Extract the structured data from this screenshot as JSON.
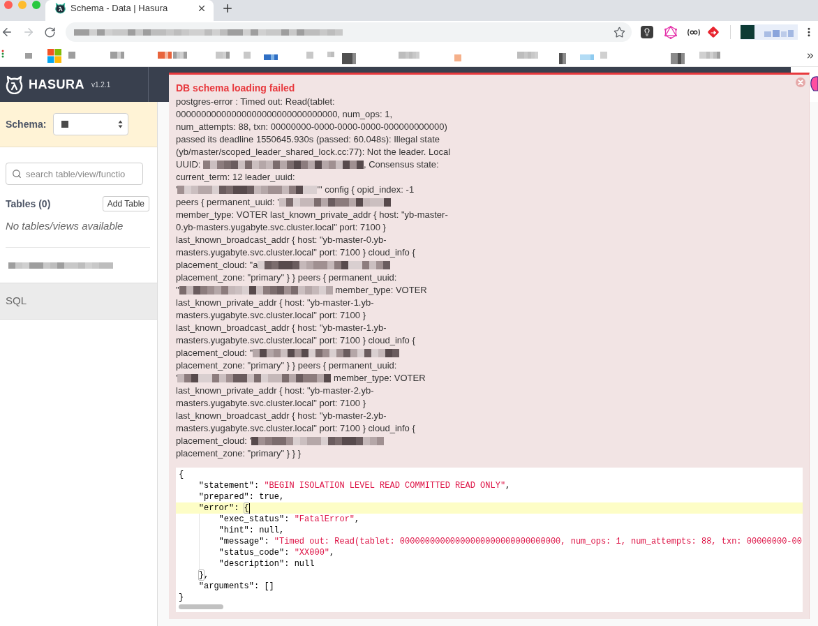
{
  "browser": {
    "tabs": [
      {
        "title": "Schema - Data | Hasura",
        "selected": true
      }
    ],
    "forward_button": {
      "disabled": true
    }
  },
  "header": {
    "logo": "HASURA",
    "version": "v1.2.1"
  },
  "sidebar": {
    "schema_label": "Schema:",
    "search": {
      "placeholder": "search table/view/functio"
    },
    "tables_heading": "Tables (0)",
    "add_table_button": "Add Table",
    "empty_message": "No tables/views available",
    "sql_link": "SQL"
  },
  "error_panel": {
    "title": "DB schema loading failed",
    "message_lines": [
      [
        {
          "kind": "text",
          "text": "postgres-error : Timed out: Read(tablet:"
        }
      ],
      [
        {
          "kind": "text",
          "text": "00000000000000000000000000000000, num_ops: 1,"
        }
      ],
      [
        {
          "kind": "text",
          "text": "num_attempts: 88, txn: 00000000-0000-0000-0000-000000000000)"
        }
      ],
      [
        {
          "kind": "text",
          "text": "passed its deadline 1550645.930s (passed: 60.048s): Illegal state"
        }
      ],
      [
        {
          "kind": "text",
          "text": "(yb/master/scoped_leader_shared_lock.cc:77): Not the leader. Local"
        }
      ],
      [
        {
          "kind": "text",
          "text": "UUID: "
        },
        {
          "kind": "redacted"
        },
        {
          "kind": "text",
          "text": ", Consensus state:"
        }
      ],
      [
        {
          "kind": "text",
          "text": "current_term: 12 leader_uuid:"
        }
      ],
      [
        {
          "kind": "text",
          "text": "'"
        },
        {
          "kind": "redacted"
        },
        {
          "kind": "text",
          "text": "'\" config { opid_index: -1"
        }
      ],
      [
        {
          "kind": "text",
          "text": "peers { permanent_uuid: '"
        },
        {
          "kind": "redacted"
        }
      ],
      [
        {
          "kind": "text",
          "text": "member_type: VOTER last_known_private_addr { host: \"yb-master-"
        }
      ],
      [
        {
          "kind": "text",
          "text": "0.yb-masters.yugabyte.svc.cluster.local\" port: 7100 }"
        }
      ],
      [
        {
          "kind": "text",
          "text": "last_known_broadcast_addr { host: \"yb-master-0.yb-"
        }
      ],
      [
        {
          "kind": "text",
          "text": "masters.yugabyte.svc.cluster.local\" port: 7100 } cloud_info {"
        }
      ],
      [
        {
          "kind": "text",
          "text": "placement_cloud: \"a"
        },
        {
          "kind": "redacted"
        }
      ],
      [
        {
          "kind": "text",
          "text": "placement_zone: \"primary\" } } peers { permanent_uuid:"
        }
      ],
      [
        {
          "kind": "text",
          "text": "\""
        },
        {
          "kind": "redacted"
        },
        {
          "kind": "text",
          "text": " member_type: VOTER"
        }
      ],
      [
        {
          "kind": "text",
          "text": "last_known_private_addr { host: \"yb-master-1.yb-"
        }
      ],
      [
        {
          "kind": "text",
          "text": "masters.yugabyte.svc.cluster.local\" port: 7100 }"
        }
      ],
      [
        {
          "kind": "text",
          "text": "last_known_broadcast_addr { host: \"yb-master-1.yb-"
        }
      ],
      [
        {
          "kind": "text",
          "text": "masters.yugabyte.svc.cluster.local\" port: 7100 } cloud_info {"
        }
      ],
      [
        {
          "kind": "text",
          "text": "placement_cloud: \""
        },
        {
          "kind": "redacted"
        }
      ],
      [
        {
          "kind": "text",
          "text": "placement_zone: \"primary\" } } peers { permanent_uuid:"
        }
      ],
      [
        {
          "kind": "text",
          "text": "'"
        },
        {
          "kind": "redacted"
        },
        {
          "kind": "text",
          "text": " member_type: VOTER"
        }
      ],
      [
        {
          "kind": "text",
          "text": "last_known_private_addr { host: \"yb-master-2.yb-"
        }
      ],
      [
        {
          "kind": "text",
          "text": "masters.yugabyte.svc.cluster.local\" port: 7100 }"
        }
      ],
      [
        {
          "kind": "text",
          "text": "last_known_broadcast_addr { host: \"yb-master-2.yb-"
        }
      ],
      [
        {
          "kind": "text",
          "text": "masters.yugabyte.svc.cluster.local\" port: 7100 } cloud_info {"
        }
      ],
      [
        {
          "kind": "text",
          "text": "placement_cloud: '"
        },
        {
          "kind": "redacted"
        }
      ],
      [
        {
          "kind": "text",
          "text": "placement_zone: \"primary\" } } }"
        }
      ]
    ],
    "code_lines": [
      {
        "text": "{",
        "active": false,
        "bracket_match": false
      },
      {
        "text": "    \"statement\": \"BEGIN ISOLATION LEVEL READ COMMITTED READ ONLY\",",
        "active": false,
        "bracket_match": false
      },
      {
        "text": "    \"prepared\": true,",
        "active": false,
        "bracket_match": false
      },
      {
        "text": "    \"error\": {",
        "active": true,
        "bracket_match": true
      },
      {
        "text": "        \"exec_status\": \"FatalError\",",
        "active": false,
        "bracket_match": false
      },
      {
        "text": "        \"hint\": null,",
        "active": false,
        "bracket_match": false
      },
      {
        "text": "        \"message\": \"Timed out: Read(tablet: 00000000000000000000000000000000, num_ops: 1, num_attempts: 88, txn: 00000000-00",
        "active": false,
        "bracket_match": false
      },
      {
        "text": "        \"status_code\": \"XX000\",",
        "active": false,
        "bracket_match": false
      },
      {
        "text": "        \"description\": null",
        "active": false,
        "bracket_match": false
      },
      {
        "text": "    },",
        "active": false,
        "bracket_match": true
      },
      {
        "text": "    \"arguments\": []",
        "active": false,
        "bracket_match": false
      },
      {
        "text": "}",
        "active": false,
        "bracket_match": false
      }
    ]
  }
}
